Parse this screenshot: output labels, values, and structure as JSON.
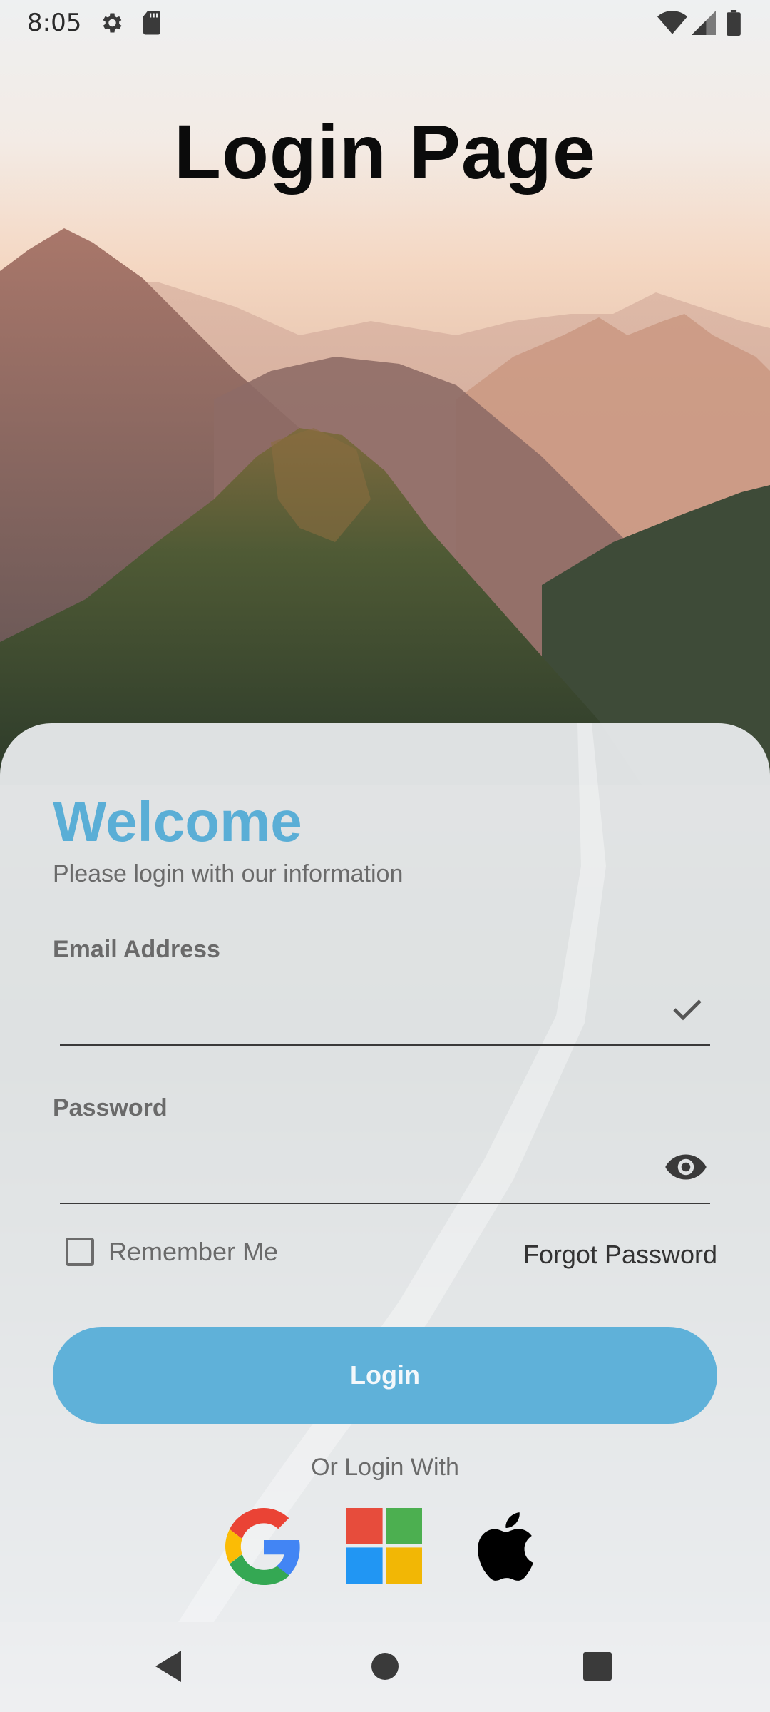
{
  "status_bar": {
    "time": "8:05",
    "icons": [
      "gear-icon",
      "sd-card-icon",
      "wifi-icon",
      "signal-icon",
      "battery-icon"
    ]
  },
  "page": {
    "title": "Login Page"
  },
  "login_card": {
    "welcome": "Welcome",
    "subtitle": "Please login with our information",
    "email": {
      "label": "Email Address",
      "value": "",
      "placeholder": "",
      "status_icon": "check-icon"
    },
    "password": {
      "label": "Password",
      "value": "",
      "placeholder": "",
      "toggle_icon": "eye-icon"
    },
    "remember_me": {
      "label": "Remember Me",
      "checked": false
    },
    "forgot_password": "Forgot Password",
    "login_button": "Login",
    "or_login_with": "Or Login With",
    "social_providers": [
      "google-icon",
      "microsoft-icon",
      "apple-icon"
    ]
  },
  "nav_bar": {
    "buttons": [
      "back-icon",
      "home-icon",
      "recents-icon"
    ]
  },
  "colors": {
    "accent": "#5aaed6",
    "button": "#5fb1d9",
    "title": "#0b0b0b",
    "muted_text": "#6a6a6a"
  }
}
